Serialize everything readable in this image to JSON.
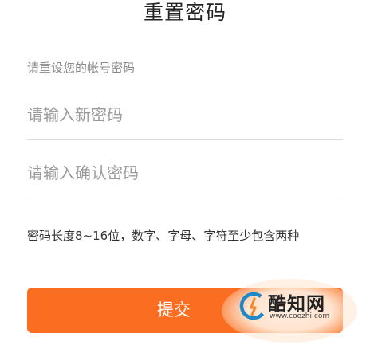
{
  "page": {
    "title": "重置密码",
    "subtitle": "请重设您的帐号密码"
  },
  "form": {
    "new_password": {
      "placeholder": "请输入新密码",
      "value": ""
    },
    "confirm_password": {
      "placeholder": "请输入确认密码",
      "value": ""
    },
    "hint": "密码长度8~16位，数字、字母、字符至少包含两种",
    "submit_label": "提交"
  },
  "watermark": {
    "name": "酷知网",
    "url": "www.coozhi.com",
    "logo_icon": "coozhi-logo-icon"
  },
  "colors": {
    "accent": "#fb6d20",
    "logo_blue": "#1e88c8",
    "logo_orange": "#f28a2e"
  }
}
